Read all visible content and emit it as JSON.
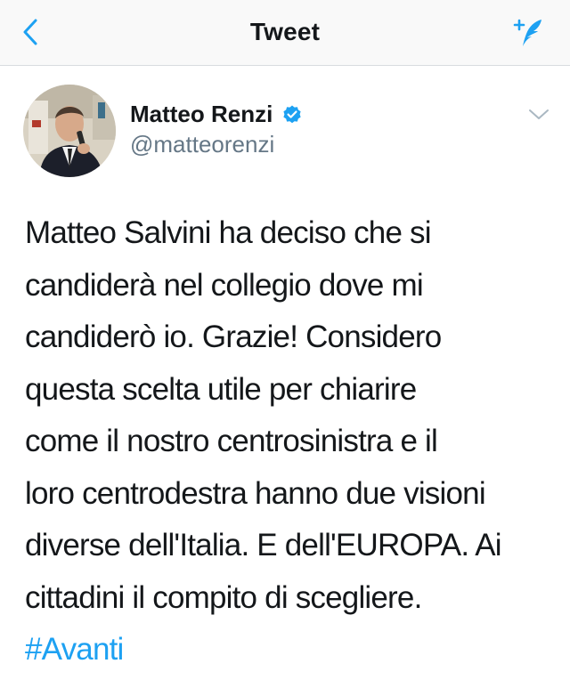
{
  "navbar": {
    "back_icon": "chevron-left-icon",
    "title": "Tweet",
    "compose_icon": "compose-tweet-icon",
    "accent_color": "#1da1f2"
  },
  "tweet": {
    "author": {
      "name": "Matteo Renzi",
      "handle": "@matteorenzi",
      "verified": true
    },
    "text_lines": [
      "Matteo Salvini ha deciso che si",
      "candiderà nel collegio dove mi",
      "candiderò io. Grazie! Considero",
      "questa scelta utile per chiarire",
      "come il nostro centrosinistra e il",
      "loro centrodestra hanno due visioni",
      "diverse dell'Italia. E dell'EUROPA. Ai",
      "cittadini il compito di scegliere."
    ],
    "hashtag": "#Avanti",
    "menu_icon": "chevron-down-icon"
  }
}
